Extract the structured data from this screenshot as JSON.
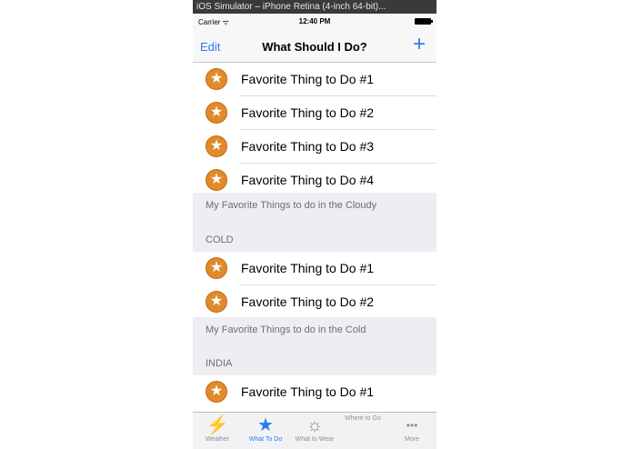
{
  "window": {
    "title": "iOS Simulator – iPhone Retina (4-inch 64-bit)..."
  },
  "status_bar": {
    "carrier": "Carrier ᯤ",
    "time": "12:40 PM"
  },
  "nav_bar": {
    "edit_label": "Edit",
    "title": "What Should I Do?",
    "add_label": "+"
  },
  "rows": {
    "r1": "Favorite Thing to Do #1",
    "r2": "Favorite Thing to Do #2",
    "r3": "Favorite Thing to Do #3",
    "r4": "Favorite Thing to Do #4",
    "r5": "Favorite Thing to Do #1",
    "r6": "Favorite Thing to Do #2",
    "r7": "Favorite Thing to Do #1"
  },
  "sections": {
    "cloudy_footer": "My Favorite Things to do in the Cloudy",
    "cold_header": "COLD",
    "cold_footer": "My Favorite Things to do in the Cold",
    "india_header": "INDIA"
  },
  "icons": {
    "row_icon": "star-badge-icon",
    "accent_color": "#2a7bf0",
    "badge_color": "#e08a2c"
  },
  "tab_bar": {
    "tabs": [
      {
        "label": "Weather",
        "icon": "lightning-icon",
        "glyph": "⚡"
      },
      {
        "label": "What To Do",
        "icon": "star-icon",
        "glyph": "★"
      },
      {
        "label": "What to Wear",
        "icon": "sun-icon",
        "glyph": "☼"
      },
      {
        "label": "Where to Go",
        "icon": "",
        "glyph": ""
      },
      {
        "label": "More",
        "icon": "more-dots-icon",
        "glyph": "•••"
      }
    ],
    "selected": "What To Do"
  }
}
